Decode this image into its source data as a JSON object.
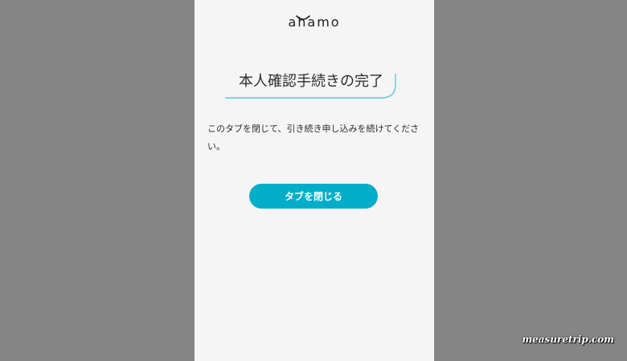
{
  "app": {
    "logo_text": "ahamo"
  },
  "page": {
    "title": "本人確認手続きの完了",
    "message": "このタブを閉じて、引き続き申し込みを続けてください。",
    "close_button_label": "タブを閉じる"
  },
  "watermark": {
    "text": "measuretrip.com"
  },
  "colors": {
    "accent": "#00aeca",
    "background": "#858585",
    "panel": "#f5f5f5",
    "curve": "#5bc8e0"
  },
  "icons": {
    "logo_smile": "smile-icon"
  }
}
